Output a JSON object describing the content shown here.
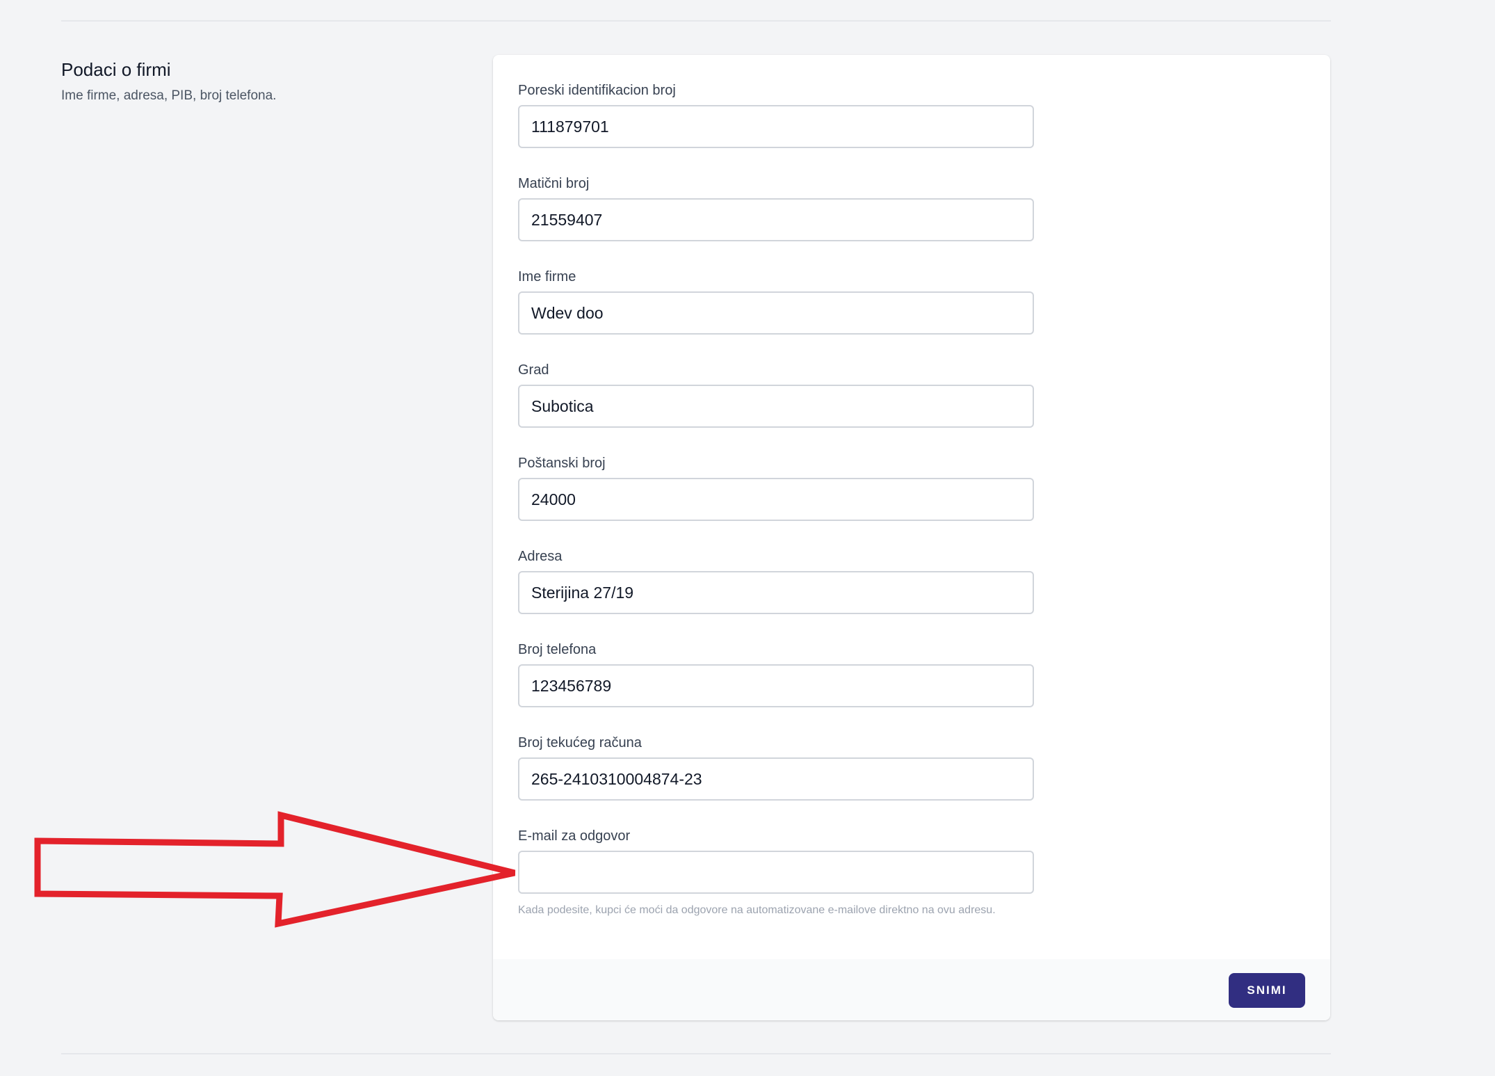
{
  "section": {
    "title": "Podaci o firmi",
    "description": "Ime firme, adresa, PIB, broj telefona."
  },
  "form": {
    "fields": [
      {
        "label": "Poreski identifikacion broj",
        "value": "111879701"
      },
      {
        "label": "Matični broj",
        "value": "21559407"
      },
      {
        "label": "Ime firme",
        "value": "Wdev doo"
      },
      {
        "label": "Grad",
        "value": "Subotica"
      },
      {
        "label": "Poštanski broj",
        "value": "24000"
      },
      {
        "label": "Adresa",
        "value": "Sterijina 27/19"
      },
      {
        "label": "Broj telefona",
        "value": "123456789"
      },
      {
        "label": "Broj tekućeg računa",
        "value": "265-2410310004874-23"
      },
      {
        "label": "E-mail za odgovor",
        "value": "",
        "hint": "Kada podesite, kupci će moći da odgovore na automatizovane e-mailove direktno na ovu adresu."
      }
    ],
    "save_label": "SNIMI"
  },
  "colors": {
    "page_background": "#f3f4f6",
    "card_background": "#ffffff",
    "footer_background": "#f9fafb",
    "primary_button": "#312e81",
    "annotation_arrow": "#e3222b"
  },
  "icons": {
    "annotation": "arrow-right-icon"
  }
}
